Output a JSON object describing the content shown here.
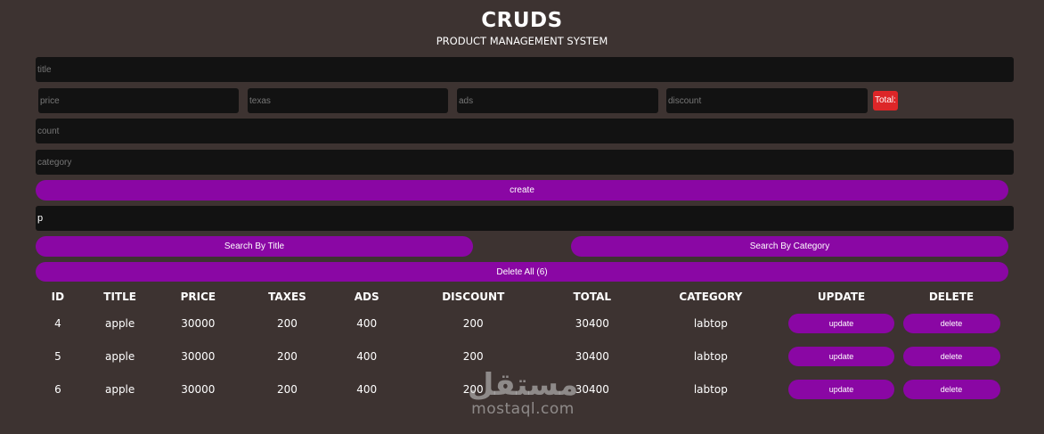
{
  "header": {
    "title": "CRUDS",
    "subtitle": "PRODUCT MANAGEMENT SYSTEM"
  },
  "form": {
    "title_placeholder": "title",
    "price_placeholder": "price",
    "taxes_placeholder": "texas",
    "ads_placeholder": "ads",
    "discount_placeholder": "discount",
    "total_label": "Total:",
    "count_placeholder": "count",
    "category_placeholder": "category",
    "create_label": "create"
  },
  "search": {
    "value": "p",
    "by_title_label": "Search By Title",
    "by_category_label": "Search By Category",
    "delete_all_label": "Delete All (6)"
  },
  "table": {
    "headers": [
      "ID",
      "TITLE",
      "PRICE",
      "TAXES",
      "ADS",
      "DISCOUNT",
      "TOTAL",
      "CATEGORY",
      "UPDATE",
      "DELETE"
    ],
    "rows": [
      {
        "id": "4",
        "title": "apple",
        "price": "30000",
        "taxes": "200",
        "ads": "400",
        "discount": "200",
        "total": "30400",
        "category": "labtop",
        "update": "update",
        "delete": "delete"
      },
      {
        "id": "5",
        "title": "apple",
        "price": "30000",
        "taxes": "200",
        "ads": "400",
        "discount": "200",
        "total": "30400",
        "category": "labtop",
        "update": "update",
        "delete": "delete"
      },
      {
        "id": "6",
        "title": "apple",
        "price": "30000",
        "taxes": "200",
        "ads": "400",
        "discount": "200",
        "total": "30400",
        "category": "labtop",
        "update": "update",
        "delete": "delete"
      }
    ]
  },
  "watermark": {
    "arabic": "مستقل",
    "latin": "mostaql.com"
  },
  "colors": {
    "background": "#3d3331",
    "input_bg": "#121212",
    "button_purple": "#8a07a4",
    "total_red": "#dd2628"
  }
}
